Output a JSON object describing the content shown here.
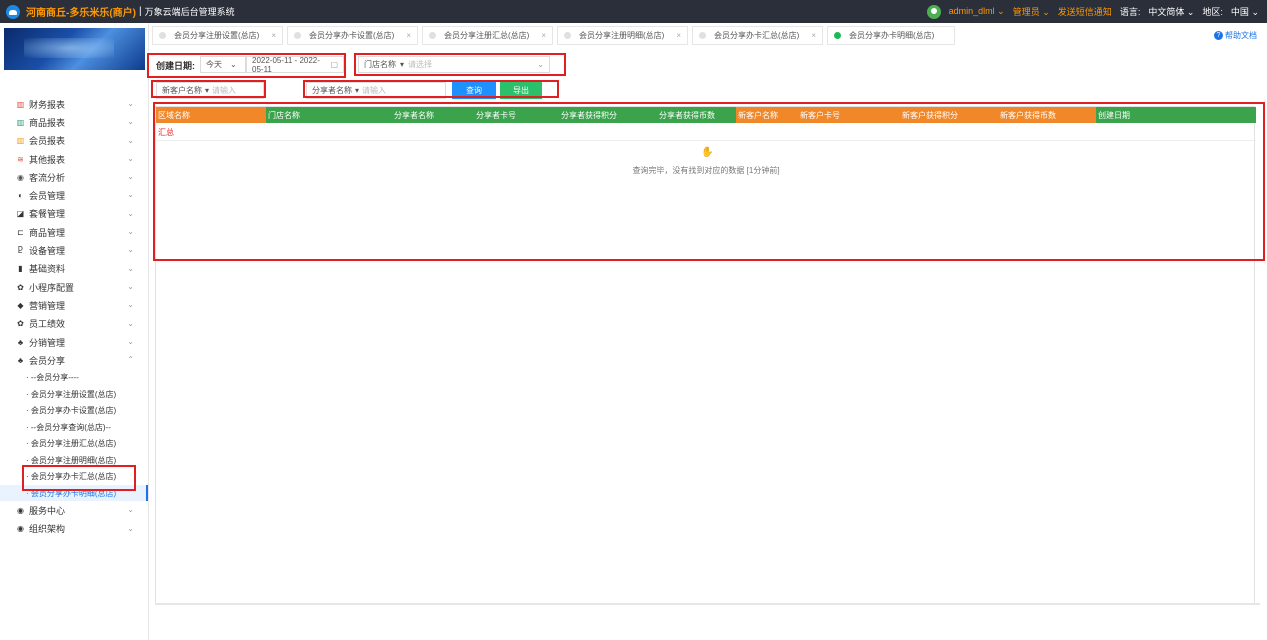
{
  "header": {
    "brand": "河南商丘-多乐米乐(商户)",
    "separator": "|",
    "subtitle": "万象云端后台管理系统",
    "user": "admin_dlml",
    "role": "管理员",
    "sms": "发送短信通知",
    "language_label": "语言:",
    "language": "中文简体",
    "region_label": "地区:",
    "region": "中国"
  },
  "tabs": [
    {
      "label": "会员分享注册设置(总店)",
      "close": "×"
    },
    {
      "label": "会员分享办卡设置(总店)",
      "close": "×"
    },
    {
      "label": "会员分享注册汇总(总店)",
      "close": "×"
    },
    {
      "label": "会员分享注册明细(总店)",
      "close": "×"
    },
    {
      "label": "会员分享办卡汇总(总店)",
      "close": "×"
    },
    {
      "label": "会员分享办卡明细(总店)",
      "close": "×"
    }
  ],
  "help": "帮助文档",
  "sidebar": {
    "items": [
      {
        "label": "财务报表",
        "icon": "chart-icon",
        "glyph": "▥",
        "color": "#e74c3c",
        "chev": "⌄"
      },
      {
        "label": "商品报表",
        "icon": "goods-report-icon",
        "glyph": "▥",
        "color": "#2e9f6e",
        "chev": "⌄"
      },
      {
        "label": "会员报表",
        "icon": "member-report-icon",
        "glyph": "▥",
        "color": "#f39c12",
        "chev": "⌄"
      },
      {
        "label": "其他报表",
        "icon": "layers-icon",
        "glyph": "≋",
        "color": "#e74c3c",
        "chev": "⌄"
      },
      {
        "label": "客流分析",
        "icon": "traffic-icon",
        "glyph": "◉",
        "color": "#555",
        "chev": "⌄"
      },
      {
        "label": "会员管理",
        "icon": "member-icon",
        "glyph": "◐",
        "color": "#333",
        "chev": "⌄"
      },
      {
        "label": "套餐管理",
        "icon": "package-icon",
        "glyph": "◪",
        "color": "#333",
        "chev": "⌄"
      },
      {
        "label": "商品管理",
        "icon": "product-icon",
        "glyph": "⊏",
        "color": "#333",
        "chev": "⌄"
      },
      {
        "label": "设备管理",
        "icon": "device-icon",
        "glyph": "Ⴒ",
        "color": "#333",
        "chev": "⌄"
      },
      {
        "label": "基础资料",
        "icon": "file-icon",
        "glyph": "▮",
        "color": "#333",
        "chev": "⌄"
      },
      {
        "label": "小程序配置",
        "icon": "gear-icon",
        "glyph": "✿",
        "color": "#333",
        "chev": "⌄"
      },
      {
        "label": "营销管理",
        "icon": "tag-icon",
        "glyph": "◆",
        "color": "#333",
        "chev": "⌄"
      },
      {
        "label": "员工绩效",
        "icon": "settings-icon",
        "glyph": "✿",
        "color": "#333",
        "chev": "⌄"
      },
      {
        "label": "分销管理",
        "icon": "share-icon",
        "glyph": "♣",
        "color": "#333",
        "chev": "⌄"
      },
      {
        "label": "会员分享",
        "icon": "member-share-icon",
        "glyph": "♣",
        "color": "#333",
        "chev": "⌃"
      }
    ],
    "sub_items": [
      "· --会员分享----",
      "· 会员分享注册设置(总店)",
      "· 会员分享办卡设置(总店)",
      "· --会员分享查询(总店)--",
      "· 会员分享注册汇总(总店)",
      "· 会员分享注册明细(总店)",
      "· 会员分享办卡汇总(总店)",
      "· 会员分享办卡明细(总店)"
    ],
    "after_items": [
      {
        "label": "服务中心",
        "icon": "service-icon",
        "glyph": "◉",
        "color": "#333",
        "chev": "⌄"
      },
      {
        "label": "组织架构",
        "icon": "org-icon",
        "glyph": "◉",
        "color": "#333",
        "chev": "⌄"
      }
    ]
  },
  "filters": {
    "date_label": "创建日期:",
    "date_preset": "今天",
    "date_range": "2022-05-11 - 2022-05-11",
    "store_label": "门店名称",
    "store_placeholder": "请选择",
    "new_customer_label": "新客户名称",
    "new_customer_placeholder": "请输入",
    "sharer_label": "分享者名称",
    "sharer_placeholder": "请输入",
    "query": "查询",
    "export": "导出"
  },
  "table": {
    "columns": [
      "区域名称",
      "门店名称",
      "分享者名称",
      "分享者卡号",
      "分享者获得积分",
      "分享者获得币数",
      "新客户名称",
      "新客户卡号",
      "新客户获得积分",
      "新客户获得币数",
      "创建日期"
    ],
    "summary": "汇总",
    "empty_message": "查询完毕，没有找到对应的数据 [1分钟前]"
  }
}
